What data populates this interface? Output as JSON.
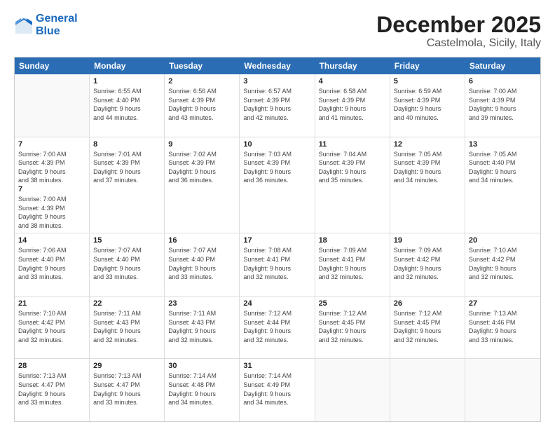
{
  "header": {
    "logo_line1": "General",
    "logo_line2": "Blue",
    "month_title": "December 2025",
    "location": "Castelmola, Sicily, Italy"
  },
  "days_of_week": [
    "Sunday",
    "Monday",
    "Tuesday",
    "Wednesday",
    "Thursday",
    "Friday",
    "Saturday"
  ],
  "weeks": [
    [
      {
        "day": "",
        "info": ""
      },
      {
        "day": "1",
        "info": "Sunrise: 6:55 AM\nSunset: 4:40 PM\nDaylight: 9 hours\nand 44 minutes."
      },
      {
        "day": "2",
        "info": "Sunrise: 6:56 AM\nSunset: 4:39 PM\nDaylight: 9 hours\nand 43 minutes."
      },
      {
        "day": "3",
        "info": "Sunrise: 6:57 AM\nSunset: 4:39 PM\nDaylight: 9 hours\nand 42 minutes."
      },
      {
        "day": "4",
        "info": "Sunrise: 6:58 AM\nSunset: 4:39 PM\nDaylight: 9 hours\nand 41 minutes."
      },
      {
        "day": "5",
        "info": "Sunrise: 6:59 AM\nSunset: 4:39 PM\nDaylight: 9 hours\nand 40 minutes."
      },
      {
        "day": "6",
        "info": "Sunrise: 7:00 AM\nSunset: 4:39 PM\nDaylight: 9 hours\nand 39 minutes."
      }
    ],
    [
      {
        "day": "7",
        "info": ""
      },
      {
        "day": "8",
        "info": "Sunrise: 7:01 AM\nSunset: 4:39 PM\nDaylight: 9 hours\nand 37 minutes."
      },
      {
        "day": "9",
        "info": "Sunrise: 7:02 AM\nSunset: 4:39 PM\nDaylight: 9 hours\nand 36 minutes."
      },
      {
        "day": "10",
        "info": "Sunrise: 7:03 AM\nSunset: 4:39 PM\nDaylight: 9 hours\nand 36 minutes."
      },
      {
        "day": "11",
        "info": "Sunrise: 7:04 AM\nSunset: 4:39 PM\nDaylight: 9 hours\nand 35 minutes."
      },
      {
        "day": "12",
        "info": "Sunrise: 7:05 AM\nSunset: 4:39 PM\nDaylight: 9 hours\nand 34 minutes."
      },
      {
        "day": "13",
        "info": "Sunrise: 7:05 AM\nSunset: 4:40 PM\nDaylight: 9 hours\nand 34 minutes."
      }
    ],
    [
      {
        "day": "14",
        "info": ""
      },
      {
        "day": "15",
        "info": "Sunrise: 7:07 AM\nSunset: 4:40 PM\nDaylight: 9 hours\nand 33 minutes."
      },
      {
        "day": "16",
        "info": "Sunrise: 7:07 AM\nSunset: 4:40 PM\nDaylight: 9 hours\nand 33 minutes."
      },
      {
        "day": "17",
        "info": "Sunrise: 7:08 AM\nSunset: 4:41 PM\nDaylight: 9 hours\nand 32 minutes."
      },
      {
        "day": "18",
        "info": "Sunrise: 7:09 AM\nSunset: 4:41 PM\nDaylight: 9 hours\nand 32 minutes."
      },
      {
        "day": "19",
        "info": "Sunrise: 7:09 AM\nSunset: 4:42 PM\nDaylight: 9 hours\nand 32 minutes."
      },
      {
        "day": "20",
        "info": "Sunrise: 7:10 AM\nSunset: 4:42 PM\nDaylight: 9 hours\nand 32 minutes."
      }
    ],
    [
      {
        "day": "21",
        "info": ""
      },
      {
        "day": "22",
        "info": "Sunrise: 7:11 AM\nSunset: 4:43 PM\nDaylight: 9 hours\nand 32 minutes."
      },
      {
        "day": "23",
        "info": "Sunrise: 7:11 AM\nSunset: 4:43 PM\nDaylight: 9 hours\nand 32 minutes."
      },
      {
        "day": "24",
        "info": "Sunrise: 7:12 AM\nSunset: 4:44 PM\nDaylight: 9 hours\nand 32 minutes."
      },
      {
        "day": "25",
        "info": "Sunrise: 7:12 AM\nSunset: 4:45 PM\nDaylight: 9 hours\nand 32 minutes."
      },
      {
        "day": "26",
        "info": "Sunrise: 7:12 AM\nSunset: 4:45 PM\nDaylight: 9 hours\nand 32 minutes."
      },
      {
        "day": "27",
        "info": "Sunrise: 7:13 AM\nSunset: 4:46 PM\nDaylight: 9 hours\nand 33 minutes."
      }
    ],
    [
      {
        "day": "28",
        "info": "Sunrise: 7:13 AM\nSunset: 4:47 PM\nDaylight: 9 hours\nand 33 minutes."
      },
      {
        "day": "29",
        "info": "Sunrise: 7:13 AM\nSunset: 4:47 PM\nDaylight: 9 hours\nand 33 minutes."
      },
      {
        "day": "30",
        "info": "Sunrise: 7:14 AM\nSunset: 4:48 PM\nDaylight: 9 hours\nand 34 minutes."
      },
      {
        "day": "31",
        "info": "Sunrise: 7:14 AM\nSunset: 4:49 PM\nDaylight: 9 hours\nand 34 minutes."
      },
      {
        "day": "",
        "info": ""
      },
      {
        "day": "",
        "info": ""
      },
      {
        "day": "",
        "info": ""
      }
    ]
  ],
  "week7_sun": {
    "day": "7",
    "info": "Sunrise: 7:00 AM\nSunset: 4:39 PM\nDaylight: 9 hours\nand 38 minutes."
  },
  "week3_sun": {
    "day": "14",
    "info": "Sunrise: 7:06 AM\nSunset: 4:40 PM\nDaylight: 9 hours\nand 33 minutes."
  },
  "week4_sun": {
    "day": "21",
    "info": "Sunrise: 7:10 AM\nSunset: 4:42 PM\nDaylight: 9 hours\nand 32 minutes."
  }
}
